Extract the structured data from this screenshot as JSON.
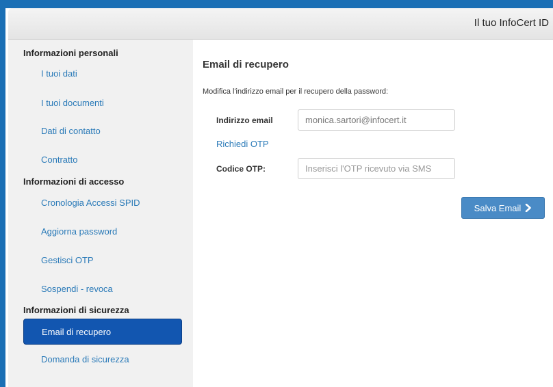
{
  "header": {
    "app_title": "Il tuo InfoCert ID"
  },
  "sidebar": {
    "sections": [
      {
        "title": "Informazioni personali",
        "items": [
          {
            "label": "I tuoi dati"
          },
          {
            "label": "I tuoi documenti"
          },
          {
            "label": "Dati di contatto"
          },
          {
            "label": "Contratto"
          }
        ]
      },
      {
        "title": "Informazioni di accesso",
        "items": [
          {
            "label": "Cronologia Accessi SPID"
          },
          {
            "label": "Aggiorna password"
          },
          {
            "label": "Gestisci OTP"
          },
          {
            "label": "Sospendi - revoca"
          }
        ]
      },
      {
        "title": "Informazioni di sicurezza",
        "items": [
          {
            "label": "Email di recupero",
            "active": true
          },
          {
            "label": "Domanda di sicurezza"
          }
        ]
      }
    ]
  },
  "main": {
    "title": "Email di recupero",
    "description": "Modifica l'indirizzo email per il recupero della password:",
    "email": {
      "label": "Indirizzo email",
      "value": "monica.sartori@infocert.it"
    },
    "otp_link": "Richiedi OTP",
    "otp": {
      "label": "Codice OTP:",
      "placeholder": "Inserisci l'OTP ricevuto via SMS",
      "value": ""
    },
    "save_button": {
      "label": "Salva Email",
      "icon": "chevron-right-icon"
    }
  },
  "colors": {
    "frame": "#1a6fb5",
    "link": "#2a7ab8",
    "active_nav": "#1256b0",
    "save_button": "#4a8bc6"
  }
}
